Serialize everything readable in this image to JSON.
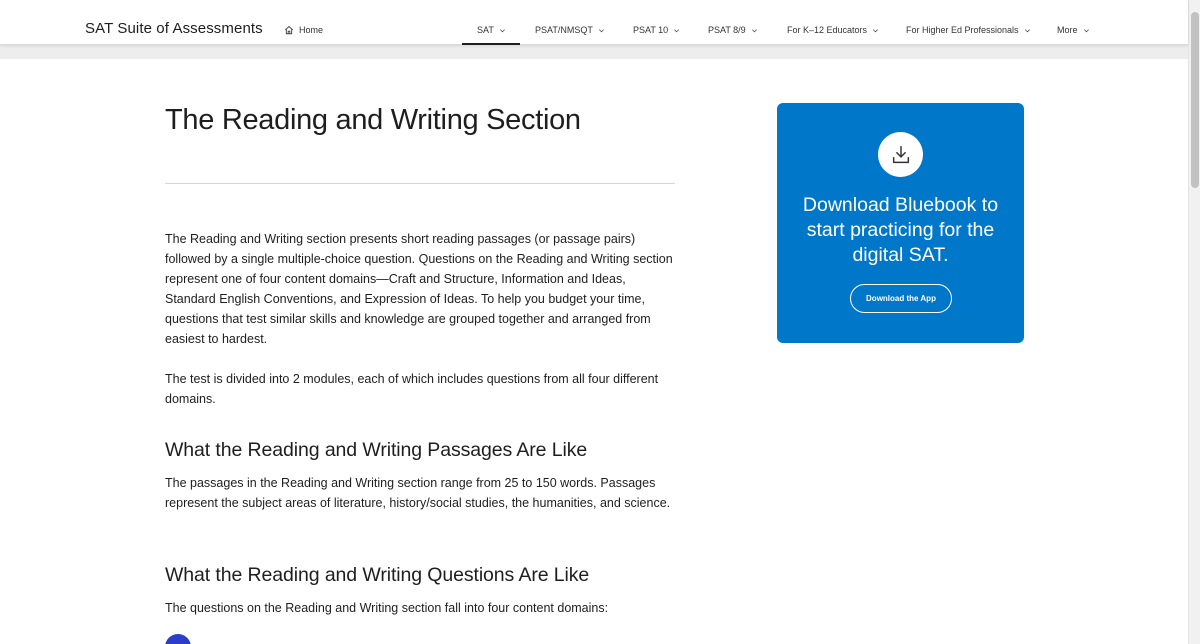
{
  "header": {
    "brand": "SAT Suite of Assessments",
    "home_label": "Home",
    "nav": [
      {
        "label": "SAT",
        "active": true
      },
      {
        "label": "PSAT/NMSQT",
        "active": false
      },
      {
        "label": "PSAT 10",
        "active": false
      },
      {
        "label": "PSAT 8/9",
        "active": false
      },
      {
        "label": "For K–12 Educators",
        "active": false
      },
      {
        "label": "For Higher Ed Professionals",
        "active": false
      },
      {
        "label": "More",
        "active": false
      }
    ]
  },
  "main": {
    "title": "The Reading and Writing Section",
    "intro": "The Reading and Writing section presents short reading passages (or passage pairs) followed by a single multiple-choice question. Questions on the Reading and Writing section represent one of four content domains—Craft and Structure, Information and Ideas, Standard English Conventions, and Expression of Ideas. To help you budget your time, questions that test similar skills and knowledge are grouped together and arranged from easiest to hardest.",
    "modules": "The test is divided into 2 modules, each of which includes questions from all four different domains.",
    "passages_heading": "What the Reading and Writing Passages Are Like",
    "passages_text": "The passages in the Reading and Writing section range from 25 to 150 words. Passages represent the subject areas of literature, history/social studies, the humanities, and science.",
    "questions_heading": "What the Reading and Writing Questions Are Like",
    "questions_text": "The questions on the Reading and Writing section fall into four content domains:"
  },
  "promo": {
    "text": "Download Bluebook to start practicing for the digital SAT.",
    "button": "Download the App",
    "icon": "download-icon"
  },
  "colors": {
    "promo_bg": "#0077c8",
    "bullet": "#2b3dc9",
    "text": "#1e1e1e"
  }
}
